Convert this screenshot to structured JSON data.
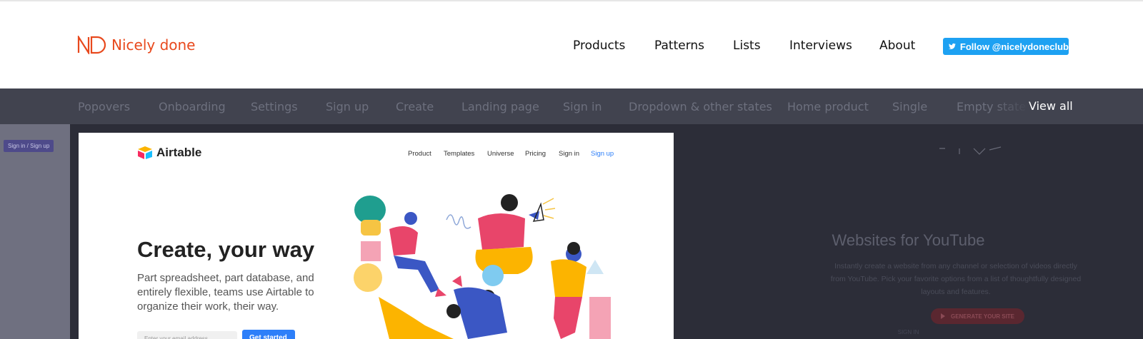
{
  "brand": {
    "name": "Nicely done",
    "color": "#e8491d"
  },
  "nav": [
    {
      "label": "Products"
    },
    {
      "label": "Patterns"
    },
    {
      "label": "Lists"
    },
    {
      "label": "Interviews"
    },
    {
      "label": "About"
    }
  ],
  "twitter": {
    "label": "Follow @nicelydoneclub",
    "icon": "twitter-bird-icon",
    "color": "#1da1f2"
  },
  "categories": [
    "Popovers",
    "Onboarding",
    "Settings",
    "Sign up",
    "Create",
    "Landing page",
    "Sign in",
    "Dropdown & other states",
    "Home product",
    "Single",
    "Empty state"
  ],
  "view_all": "View all",
  "left_card": {
    "badge": "Sign in / Sign up"
  },
  "main_card": {
    "logo": "Airtable",
    "nav": [
      "Product",
      "Templates",
      "Universe",
      "Pricing",
      "Sign in",
      "Sign up"
    ],
    "title": "Create, your way",
    "subtitle": "Part spreadsheet, part database, and entirely flexible, teams use Airtable to organize their work, their way.",
    "email_placeholder": "Enter your email address",
    "cta": "Get started"
  },
  "right_card": {
    "title": "Websites for YouTube",
    "description": "Instantly create a website from any channel or selection of videos directly from YouTube. Pick your favorite options from a list of thoughtfully designed layouts and features.",
    "button": "GENERATE YOUR SITE",
    "sign_in": "SIGN IN"
  }
}
